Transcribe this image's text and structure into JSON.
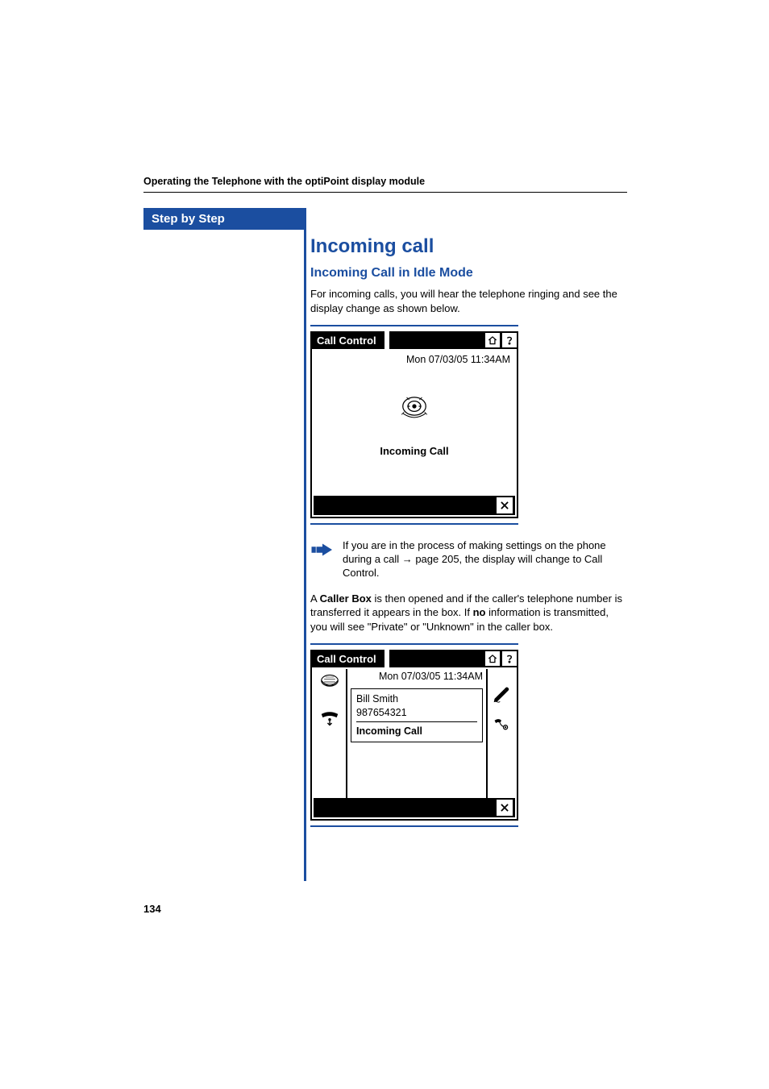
{
  "header": {
    "running": "Operating the Telephone with the optiPoint display module"
  },
  "sidebar": {
    "label": "Step by Step"
  },
  "section": {
    "h1": "Incoming call",
    "h2": "Incoming Call in Idle Mode",
    "intro": "For incoming calls, you will hear the telephone ringing and see the display change as shown below."
  },
  "panel1": {
    "title": "Call Control",
    "datetime": "Mon 07/03/05 11:34AM",
    "label": "Incoming Call"
  },
  "note": {
    "text_a": "If you are in the process of making settings on the phone during a call ",
    "arrow": "→",
    "page_ref": " page 205, the display will change to Call Control."
  },
  "para2": {
    "a": "A ",
    "bold1": "Caller Box",
    "b": " is then opened and if the caller's telephone number is transferred it appears in the box. If ",
    "bold2": "no",
    "c": " information is transmitted, you will see \"Private\" or \"Unknown\" in the caller box."
  },
  "panel2": {
    "title": "Call Control",
    "datetime": "Mon 07/03/05 11:34AM",
    "caller_name": "Bill Smith",
    "caller_number": "987654321",
    "label": "Incoming Call"
  },
  "page_number": "134"
}
